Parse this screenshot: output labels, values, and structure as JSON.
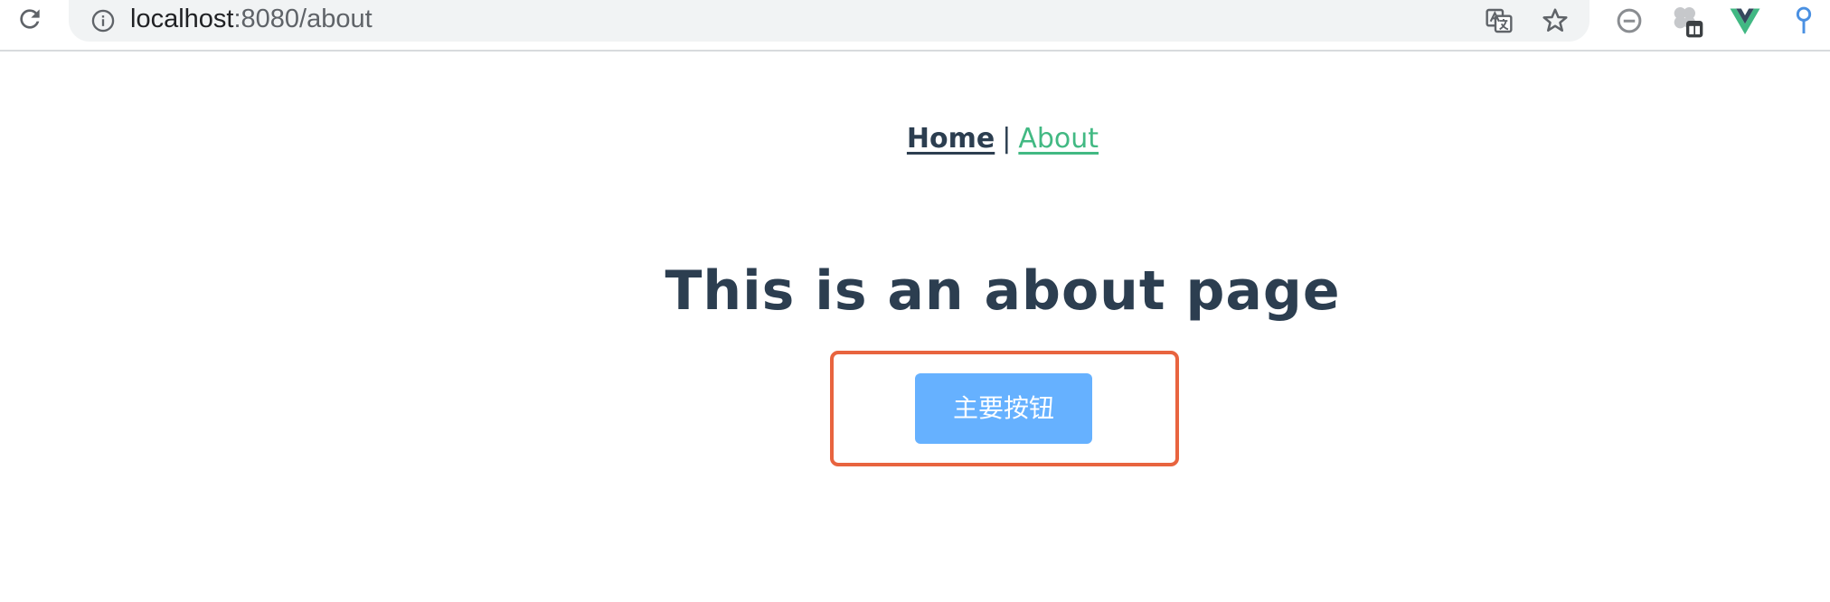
{
  "browser": {
    "url_host": "localhost",
    "url_rest": ":8080/about",
    "icons": [
      "reload-icon",
      "site-info-icon",
      "translate-icon",
      "bookmark-star-icon",
      "extension-minus-icon",
      "extension-clover-icon",
      "vue-devtools-icon",
      "extension-pin-icon"
    ]
  },
  "nav": {
    "home_label": "Home",
    "separator": "|",
    "about_label": "About"
  },
  "page": {
    "title": "This is an about page",
    "primary_button_label": "主要按钮"
  },
  "colors": {
    "text_primary": "#2c3e50",
    "link_active": "#42b983",
    "button_primary": "#66b1ff",
    "highlight_border": "#e8643f",
    "toolbar_bg": "#f1f3f4"
  }
}
